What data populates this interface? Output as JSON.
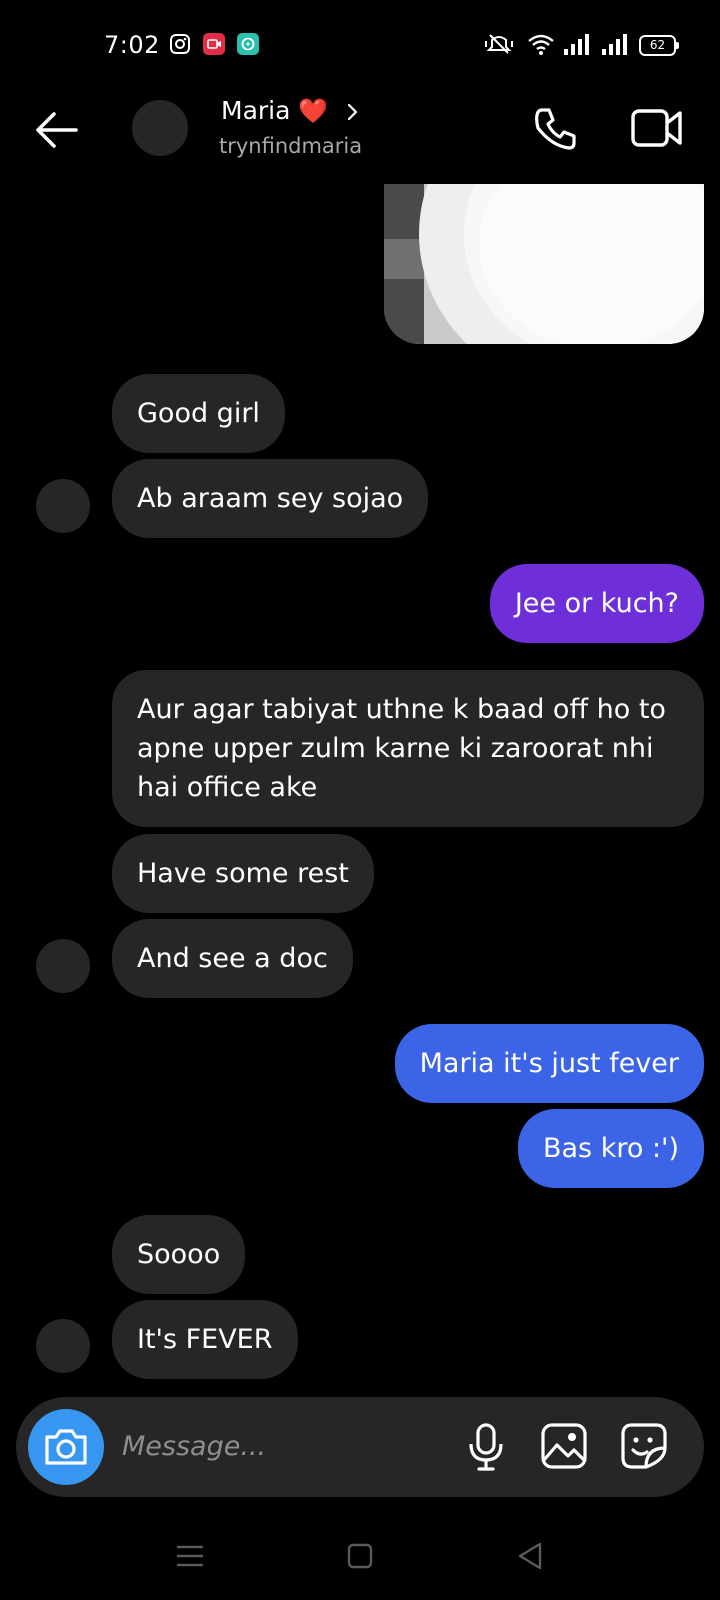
{
  "status_bar": {
    "time": "7:02",
    "battery": "62",
    "icons": [
      "instagram-icon",
      "screen-recorder-icon",
      "chat-app-icon",
      "mute-vibrate-icon",
      "wifi-icon",
      "signal-icon",
      "signal-icon-2",
      "battery-icon"
    ]
  },
  "header": {
    "name": "Maria",
    "heart": "❤️",
    "username": "trynfindmaria",
    "icons": [
      "back-arrow-icon",
      "chevron-right-icon",
      "phone-icon",
      "video-icon"
    ]
  },
  "messages": [
    {
      "sender": "them",
      "text": "Good girl"
    },
    {
      "sender": "them",
      "text": "Ab araam sey sojao"
    },
    {
      "sender": "me",
      "text": "Jee or kuch?"
    },
    {
      "sender": "them",
      "text": "Aur agar tabiyat uthne k baad off ho to apne upper zulm karne ki zaroorat nhi hai office ake"
    },
    {
      "sender": "them",
      "text": "Have some rest"
    },
    {
      "sender": "them",
      "text": "And see a doc"
    },
    {
      "sender": "me",
      "text": "Maria it's just fever"
    },
    {
      "sender": "me",
      "text": "Bas kro :')"
    },
    {
      "sender": "them",
      "text": "Soooo"
    },
    {
      "sender": "them",
      "text": "It's FEVER"
    }
  ],
  "composer": {
    "placeholder": "Message...",
    "icons": [
      "camera-icon",
      "microphone-icon",
      "gallery-icon",
      "sticker-icon"
    ]
  },
  "nav_bar": {
    "icons": [
      "menu-icon",
      "home-square-icon",
      "back-triangle-icon"
    ]
  },
  "colors": {
    "background": "#000000",
    "incoming_bubble": "#262626",
    "outgoing_purple": "#6e2fd9",
    "outgoing_blue": "#3b65e6",
    "camera_button": "#3797f0"
  }
}
